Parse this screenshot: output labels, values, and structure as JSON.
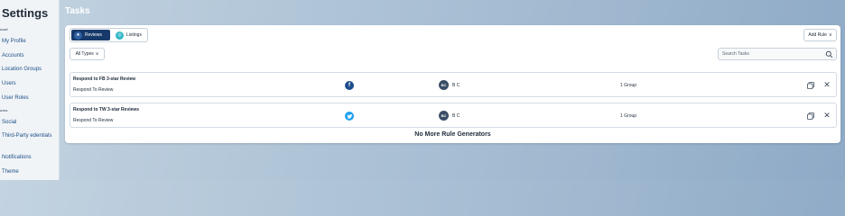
{
  "sidebar": {
    "title": "Settings",
    "section_account": "ount",
    "section_features": "ures",
    "items": [
      {
        "label": "My Profile"
      },
      {
        "label": "Accounts"
      },
      {
        "label": "Location Groups"
      },
      {
        "label": "Users"
      },
      {
        "label": "User Roles"
      },
      {
        "label": "Social"
      },
      {
        "label": "Third-Party edentials"
      },
      {
        "label": "Notifications"
      },
      {
        "label": "Theme"
      }
    ]
  },
  "page": {
    "title": "Tasks"
  },
  "tabs": {
    "reviews": "Reviews",
    "listings": "Listings"
  },
  "toolbar": {
    "add_rule": "Add Rule",
    "all_types": "All Types",
    "search_placeholder": "Search Tasks"
  },
  "rows": [
    {
      "title": "Respond to FB 3-star Review",
      "subtitle": "Respond To Review",
      "network_icon": "facebook-icon",
      "network_glyph": "f",
      "avatar_initials": "BC",
      "owner": "B C",
      "group": "1 Group"
    },
    {
      "title": "Respond to TW 3-star Reviews",
      "subtitle": "Respond To Review",
      "network_icon": "twitter-icon",
      "network_glyph": "🐦",
      "avatar_initials": "BC",
      "owner": "B C",
      "group": "1 Group"
    }
  ],
  "footer": {
    "no_more": "No More Rule Generators"
  },
  "colors": {
    "accent": "#173a6b",
    "facebook": "#1e4d8c",
    "twitter": "#1da1f2",
    "listings": "#30b7c7"
  }
}
